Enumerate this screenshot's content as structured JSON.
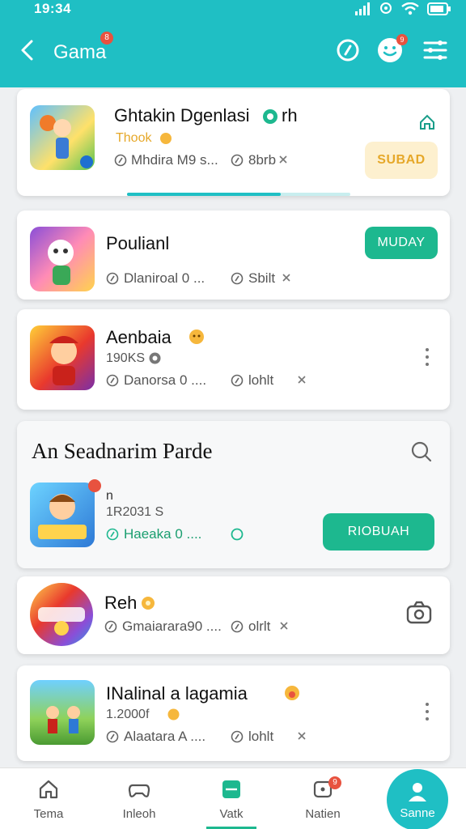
{
  "status_bar": {
    "time": "19:34"
  },
  "header": {
    "title": "Gama",
    "badge": "8",
    "profile_badge": "9"
  },
  "cards": [
    {
      "title": "Ghtakin Dgenlasi",
      "title_suffix": "rh",
      "subtitle": "Thook",
      "meta1": "Mhdira M9 s...",
      "meta2": "8brb",
      "action_label": "SUBAD"
    },
    {
      "title": "Poulianl",
      "meta1": "Dlaniroal 0 ...",
      "meta2": "Sbilt",
      "action_label": "MUDAY"
    },
    {
      "title": "Aenbaia",
      "subtitle": "190KS",
      "meta1": "Danorsa 0 ....",
      "meta2": "lohlt"
    },
    {
      "header": "An Seadnarim Parde",
      "title": "n",
      "subtitle": "1R2031 S",
      "meta1": "Haeaka 0 ....",
      "action_label": "RIOBUAH"
    },
    {
      "title": "Reh",
      "meta1": "Gmaiarara90 ....",
      "meta2": "olrlt"
    },
    {
      "title": "INalinal a lagamia",
      "subtitle": "1.2000f",
      "meta1": "Alaatara A ....",
      "meta2": "lohlt"
    }
  ],
  "bottom_nav": [
    {
      "label": "Tema",
      "icon": "home-icon"
    },
    {
      "label": "Inleoh",
      "icon": "controller-icon"
    },
    {
      "label": "Vatk",
      "icon": "list-icon"
    },
    {
      "label": "Natien",
      "icon": "notification-icon",
      "badge": "9"
    },
    {
      "label": "Sanne",
      "icon": "profile-icon"
    }
  ],
  "colors": {
    "teal": "#1fbfc4",
    "green": "#1db88f",
    "badge_red": "#e8523f",
    "gold": "#f6b73c"
  }
}
